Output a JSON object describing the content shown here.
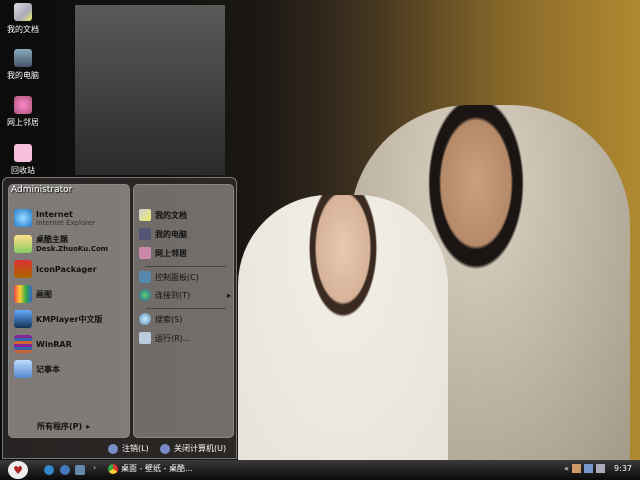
{
  "desktop": {
    "icons": [
      {
        "label": "我的文档"
      },
      {
        "label": "我的电脑"
      },
      {
        "label": "网上邻居"
      },
      {
        "label": "回收站"
      }
    ]
  },
  "start_menu": {
    "user": "Administrator",
    "pinned": [
      {
        "label": "Internet",
        "sub": "Internet Explorer",
        "icon": "ie-icon"
      },
      {
        "label": "桌酷主题",
        "sub": "Desk.ZhuoKu.Com",
        "icon": "theme-icon"
      },
      {
        "label": "IconPackager",
        "icon": "iconpackager-icon"
      },
      {
        "label": "画图",
        "icon": "paint-icon"
      },
      {
        "label": "KMPlayer中文版",
        "icon": "kmplayer-icon"
      },
      {
        "label": "WinRAR",
        "icon": "winrar-icon"
      },
      {
        "label": "记事本",
        "icon": "notepad-icon"
      }
    ],
    "all_programs": "所有程序(P)",
    "right": [
      {
        "label": "我的文档"
      },
      {
        "label": "我的电脑"
      },
      {
        "label": "网上邻居"
      },
      {
        "label": "控制面板(C)"
      },
      {
        "label": "连接到(T)"
      },
      {
        "label": "搜索(S)"
      },
      {
        "label": "运行(R)..."
      }
    ],
    "logoff": "注销(L)",
    "shutdown": "关闭计算机(U)"
  },
  "taskbar": {
    "task": "桌面 - 壁纸 - 桌酷...",
    "clock": "9:37"
  }
}
